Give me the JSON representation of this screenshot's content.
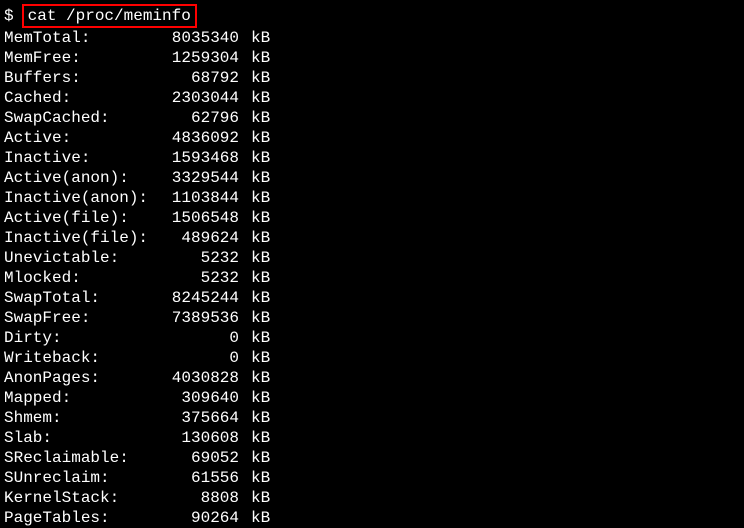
{
  "prompt": "$",
  "command": "cat /proc/meminfo",
  "rows": [
    {
      "label": "MemTotal:",
      "value": "8035340",
      "unit": "kB"
    },
    {
      "label": "MemFree:",
      "value": "1259304",
      "unit": "kB"
    },
    {
      "label": "Buffers:",
      "value": "68792",
      "unit": "kB"
    },
    {
      "label": "Cached:",
      "value": "2303044",
      "unit": "kB"
    },
    {
      "label": "SwapCached:",
      "value": "62796",
      "unit": "kB"
    },
    {
      "label": "Active:",
      "value": "4836092",
      "unit": "kB"
    },
    {
      "label": "Inactive:",
      "value": "1593468",
      "unit": "kB"
    },
    {
      "label": "Active(anon):",
      "value": "3329544",
      "unit": "kB"
    },
    {
      "label": "Inactive(anon):",
      "value": "1103844",
      "unit": "kB"
    },
    {
      "label": "Active(file):",
      "value": "1506548",
      "unit": "kB"
    },
    {
      "label": "Inactive(file):",
      "value": "489624",
      "unit": "kB"
    },
    {
      "label": "Unevictable:",
      "value": "5232",
      "unit": "kB"
    },
    {
      "label": "Mlocked:",
      "value": "5232",
      "unit": "kB"
    },
    {
      "label": "SwapTotal:",
      "value": "8245244",
      "unit": "kB"
    },
    {
      "label": "SwapFree:",
      "value": "7389536",
      "unit": "kB"
    },
    {
      "label": "Dirty:",
      "value": "0",
      "unit": "kB"
    },
    {
      "label": "Writeback:",
      "value": "0",
      "unit": "kB"
    },
    {
      "label": "AnonPages:",
      "value": "4030828",
      "unit": "kB"
    },
    {
      "label": "Mapped:",
      "value": "309640",
      "unit": "kB"
    },
    {
      "label": "Shmem:",
      "value": "375664",
      "unit": "kB"
    },
    {
      "label": "Slab:",
      "value": "130608",
      "unit": "kB"
    },
    {
      "label": "SReclaimable:",
      "value": "69052",
      "unit": "kB"
    },
    {
      "label": "SUnreclaim:",
      "value": "61556",
      "unit": "kB"
    },
    {
      "label": "KernelStack:",
      "value": "8808",
      "unit": "kB"
    },
    {
      "label": "PageTables:",
      "value": "90264",
      "unit": "kB"
    }
  ]
}
